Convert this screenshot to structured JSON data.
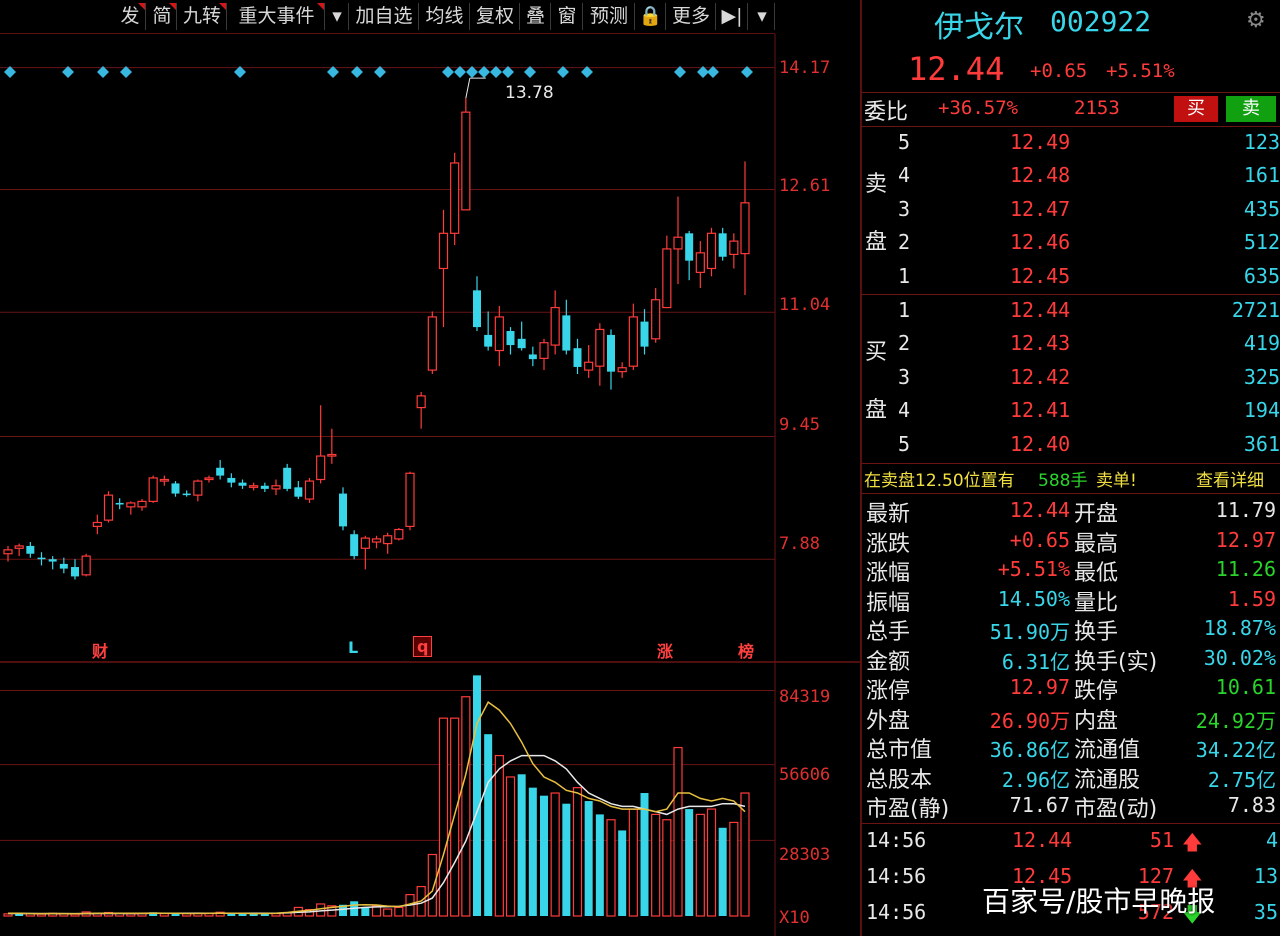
{
  "toolbar": {
    "items": [
      "发",
      "简",
      "九转",
      "重大事件",
      "▾",
      "加自选",
      "均线",
      "复权",
      "叠",
      "窗",
      "预测",
      "🔒",
      "更多",
      "▶|",
      "▾"
    ]
  },
  "price_axis": {
    "ticks": [
      "14.17",
      "12.61",
      "11.04",
      "9.45",
      "7.88"
    ]
  },
  "volume_axis": {
    "ticks": [
      "84319",
      "56606",
      "28303",
      "X10"
    ]
  },
  "chart_annotation": {
    "high_label": "13.78"
  },
  "event_markers": [
    "财",
    "L",
    "q",
    "涨",
    "榜"
  ],
  "stock": {
    "name": "伊戈尔",
    "code": "002922",
    "price": "12.44",
    "change": "+0.65",
    "change_pct": "+5.51%"
  },
  "weibi": {
    "label": "委比",
    "pct": "+36.57%",
    "diff": "2153",
    "buy_label": "买",
    "sell_label": "卖"
  },
  "sell_side": {
    "label_top": "卖",
    "label_bottom": "盘",
    "levels": [
      {
        "idx": "5",
        "price": "12.49",
        "vol": "123"
      },
      {
        "idx": "4",
        "price": "12.48",
        "vol": "161"
      },
      {
        "idx": "3",
        "price": "12.47",
        "vol": "435"
      },
      {
        "idx": "2",
        "price": "12.46",
        "vol": "512"
      },
      {
        "idx": "1",
        "price": "12.45",
        "vol": "635"
      }
    ]
  },
  "buy_side": {
    "label_top": "买",
    "label_bottom": "盘",
    "levels": [
      {
        "idx": "1",
        "price": "12.44",
        "vol": "2721"
      },
      {
        "idx": "2",
        "price": "12.43",
        "vol": "419"
      },
      {
        "idx": "3",
        "price": "12.42",
        "vol": "325"
      },
      {
        "idx": "4",
        "price": "12.41",
        "vol": "194"
      },
      {
        "idx": "5",
        "price": "12.40",
        "vol": "361"
      }
    ]
  },
  "alert": {
    "prefix": "在卖盘12.50位置有",
    "qty": "588手",
    "suffix": "卖单!",
    "link": "查看详细"
  },
  "stats": [
    {
      "l1": "最新",
      "v1": "12.44",
      "c1": "red",
      "l2": "开盘",
      "v2": "11.79",
      "c2": "white"
    },
    {
      "l1": "涨跌",
      "v1": "+0.65",
      "c1": "red",
      "l2": "最高",
      "v2": "12.97",
      "c2": "red"
    },
    {
      "l1": "涨幅",
      "v1": "+5.51%",
      "c1": "red",
      "l2": "最低",
      "v2": "11.26",
      "c2": "green"
    },
    {
      "l1": "振幅",
      "v1": "14.50%",
      "c1": "cyan",
      "l2": "量比",
      "v2": "1.59",
      "c2": "red"
    },
    {
      "l1": "总手",
      "v1": "51.90万",
      "c1": "cyan",
      "l2": "换手",
      "v2": "18.87%",
      "c2": "cyan"
    },
    {
      "l1": "金额",
      "v1": "6.31亿",
      "c1": "cyan",
      "l2": "换手(实)",
      "v2": "30.02%",
      "c2": "cyan"
    },
    {
      "l1": "涨停",
      "v1": "12.97",
      "c1": "red",
      "l2": "跌停",
      "v2": "10.61",
      "c2": "green"
    },
    {
      "l1": "外盘",
      "v1": "26.90万",
      "c1": "red",
      "l2": "内盘",
      "v2": "24.92万",
      "c2": "green"
    },
    {
      "l1": "总市值",
      "v1": "36.86亿",
      "c1": "cyan",
      "l2": "流通值",
      "v2": "34.22亿",
      "c2": "cyan"
    },
    {
      "l1": "总股本",
      "v1": "2.96亿",
      "c1": "cyan",
      "l2": "流通股",
      "v2": "2.75亿",
      "c2": "cyan"
    },
    {
      "l1": "市盈(静)",
      "v1": "71.67",
      "c1": "white",
      "l2": "市盈(动)",
      "v2": "7.83",
      "c2": "white"
    }
  ],
  "trades": [
    {
      "time": "14:56",
      "price": "12.44",
      "vol": "51",
      "dir": "up",
      "count": "4"
    },
    {
      "time": "14:56",
      "price": "12.45",
      "vol": "127",
      "dir": "up",
      "count": "13"
    },
    {
      "time": "14:56",
      "price": "",
      "vol": "572",
      "dir": "down",
      "count": "35"
    }
  ],
  "watermark": "百家号/股市早晚报",
  "colors": {
    "up": "#ff3b3b",
    "down": "#38d6e8",
    "grid": "#6a1414",
    "ma5": "#e8c040",
    "ma10": "#e8e8e8"
  },
  "chart_data": {
    "type": "candlestick",
    "y_range": [
      7.0,
      14.6
    ],
    "candles": [
      {
        "o": 7.95,
        "h": 8.05,
        "l": 7.85,
        "c": 8.0
      },
      {
        "o": 8.02,
        "h": 8.08,
        "l": 7.92,
        "c": 8.05
      },
      {
        "o": 8.05,
        "h": 8.1,
        "l": 7.9,
        "c": 7.95
      },
      {
        "o": 7.9,
        "h": 7.97,
        "l": 7.8,
        "c": 7.88
      },
      {
        "o": 7.88,
        "h": 7.92,
        "l": 7.75,
        "c": 7.85
      },
      {
        "o": 7.82,
        "h": 7.9,
        "l": 7.7,
        "c": 7.76
      },
      {
        "o": 7.78,
        "h": 7.88,
        "l": 7.62,
        "c": 7.66
      },
      {
        "o": 7.68,
        "h": 7.95,
        "l": 7.66,
        "c": 7.92
      },
      {
        "o": 8.3,
        "h": 8.45,
        "l": 8.2,
        "c": 8.35
      },
      {
        "o": 8.38,
        "h": 8.75,
        "l": 8.35,
        "c": 8.7
      },
      {
        "o": 8.6,
        "h": 8.66,
        "l": 8.52,
        "c": 8.58
      },
      {
        "o": 8.55,
        "h": 8.62,
        "l": 8.45,
        "c": 8.6
      },
      {
        "o": 8.55,
        "h": 8.65,
        "l": 8.5,
        "c": 8.62
      },
      {
        "o": 8.62,
        "h": 8.95,
        "l": 8.6,
        "c": 8.92
      },
      {
        "o": 8.88,
        "h": 8.95,
        "l": 8.82,
        "c": 8.9
      },
      {
        "o": 8.85,
        "h": 8.88,
        "l": 8.68,
        "c": 8.72
      },
      {
        "o": 8.72,
        "h": 8.76,
        "l": 8.68,
        "c": 8.7
      },
      {
        "o": 8.7,
        "h": 8.9,
        "l": 8.62,
        "c": 8.88
      },
      {
        "o": 8.9,
        "h": 8.95,
        "l": 8.86,
        "c": 8.92
      },
      {
        "o": 9.05,
        "h": 9.15,
        "l": 8.9,
        "c": 8.95
      },
      {
        "o": 8.92,
        "h": 8.98,
        "l": 8.8,
        "c": 8.86
      },
      {
        "o": 8.86,
        "h": 8.9,
        "l": 8.78,
        "c": 8.82
      },
      {
        "o": 8.8,
        "h": 8.86,
        "l": 8.76,
        "c": 8.82
      },
      {
        "o": 8.82,
        "h": 8.86,
        "l": 8.74,
        "c": 8.78
      },
      {
        "o": 8.78,
        "h": 8.9,
        "l": 8.7,
        "c": 8.82
      },
      {
        "o": 9.05,
        "h": 9.1,
        "l": 8.75,
        "c": 8.78
      },
      {
        "o": 8.8,
        "h": 8.88,
        "l": 8.65,
        "c": 8.68
      },
      {
        "o": 8.65,
        "h": 8.92,
        "l": 8.6,
        "c": 8.88
      },
      {
        "o": 8.9,
        "h": 9.85,
        "l": 8.85,
        "c": 9.2
      },
      {
        "o": 9.2,
        "h": 9.55,
        "l": 9.1,
        "c": 9.22
      },
      {
        "o": 8.72,
        "h": 8.8,
        "l": 8.25,
        "c": 8.3
      },
      {
        "o": 8.2,
        "h": 8.25,
        "l": 7.88,
        "c": 7.92
      },
      {
        "o": 8.02,
        "h": 8.18,
        "l": 7.75,
        "c": 8.15
      },
      {
        "o": 8.1,
        "h": 8.18,
        "l": 8.02,
        "c": 8.14
      },
      {
        "o": 8.08,
        "h": 8.22,
        "l": 7.95,
        "c": 8.18
      },
      {
        "o": 8.14,
        "h": 8.28,
        "l": 8.12,
        "c": 8.26
      },
      {
        "o": 8.3,
        "h": 9.0,
        "l": 8.25,
        "c": 8.98
      },
      {
        "o": 9.82,
        "h": 10.02,
        "l": 9.55,
        "c": 9.97
      },
      {
        "o": 10.3,
        "h": 11.05,
        "l": 10.25,
        "c": 10.98
      },
      {
        "o": 11.6,
        "h": 12.35,
        "l": 10.85,
        "c": 12.05
      },
      {
        "o": 12.05,
        "h": 13.08,
        "l": 11.9,
        "c": 12.95
      },
      {
        "o": 12.35,
        "h": 13.78,
        "l": 12.35,
        "c": 13.6
      },
      {
        "o": 11.32,
        "h": 11.5,
        "l": 10.8,
        "c": 10.85
      },
      {
        "o": 10.75,
        "h": 11.05,
        "l": 10.55,
        "c": 10.6
      },
      {
        "o": 10.55,
        "h": 11.12,
        "l": 10.35,
        "c": 10.98
      },
      {
        "o": 10.8,
        "h": 10.85,
        "l": 10.5,
        "c": 10.62
      },
      {
        "o": 10.7,
        "h": 10.92,
        "l": 10.55,
        "c": 10.58
      },
      {
        "o": 10.5,
        "h": 10.6,
        "l": 10.35,
        "c": 10.44
      },
      {
        "o": 10.45,
        "h": 10.7,
        "l": 10.3,
        "c": 10.65
      },
      {
        "o": 10.62,
        "h": 11.32,
        "l": 10.5,
        "c": 11.1
      },
      {
        "o": 11.0,
        "h": 11.2,
        "l": 10.5,
        "c": 10.55
      },
      {
        "o": 10.58,
        "h": 10.7,
        "l": 10.25,
        "c": 10.34
      },
      {
        "o": 10.3,
        "h": 10.62,
        "l": 10.2,
        "c": 10.4
      },
      {
        "o": 10.35,
        "h": 10.9,
        "l": 10.1,
        "c": 10.82
      },
      {
        "o": 10.75,
        "h": 10.82,
        "l": 10.05,
        "c": 10.28
      },
      {
        "o": 10.28,
        "h": 10.4,
        "l": 10.2,
        "c": 10.33
      },
      {
        "o": 10.35,
        "h": 11.15,
        "l": 10.3,
        "c": 10.98
      },
      {
        "o": 10.92,
        "h": 11.08,
        "l": 10.5,
        "c": 10.6
      },
      {
        "o": 10.7,
        "h": 11.35,
        "l": 10.65,
        "c": 11.2
      },
      {
        "o": 11.1,
        "h": 12.02,
        "l": 11.1,
        "c": 11.85
      },
      {
        "o": 11.85,
        "h": 12.52,
        "l": 11.4,
        "c": 12.0
      },
      {
        "o": 12.05,
        "h": 12.08,
        "l": 11.45,
        "c": 11.7
      },
      {
        "o": 11.55,
        "h": 11.95,
        "l": 11.35,
        "c": 11.8
      },
      {
        "o": 11.6,
        "h": 12.12,
        "l": 11.5,
        "c": 12.05
      },
      {
        "o": 12.05,
        "h": 12.12,
        "l": 11.7,
        "c": 11.75
      },
      {
        "o": 11.78,
        "h": 12.05,
        "l": 11.6,
        "c": 11.95
      },
      {
        "o": 11.79,
        "h": 12.97,
        "l": 11.26,
        "c": 12.44
      }
    ],
    "volume_y_range": [
      0,
      95000
    ],
    "volumes": [
      800,
      1200,
      900,
      700,
      1000,
      800,
      700,
      1500,
      900,
      1300,
      1000,
      800,
      900,
      1400,
      900,
      800,
      900,
      1100,
      900,
      1400,
      1000,
      900,
      800,
      1000,
      900,
      1300,
      3200,
      2400,
      4500,
      3800,
      4200,
      5500,
      3000,
      3800,
      2600,
      3200,
      8000,
      11000,
      23000,
      74000,
      74000,
      82000,
      90000,
      68000,
      60000,
      52000,
      53000,
      48000,
      45000,
      46000,
      42000,
      48000,
      43000,
      38000,
      36000,
      32000,
      40000,
      46000,
      38000,
      36000,
      63000,
      40000,
      38000,
      40000,
      33000,
      35000,
      46000
    ],
    "volume_colors": [
      "up",
      "down",
      "up",
      "up",
      "up",
      "up",
      "up",
      "up",
      "up",
      "up",
      "up",
      "up",
      "up",
      "down",
      "up",
      "down",
      "up",
      "up",
      "up",
      "up",
      "down",
      "down",
      "down",
      "down",
      "up",
      "up",
      "up",
      "up",
      "up",
      "up",
      "down",
      "down",
      "down",
      "up",
      "up",
      "up",
      "up",
      "up",
      "up",
      "up",
      "up",
      "up",
      "down",
      "down",
      "up",
      "up",
      "down",
      "down",
      "down",
      "up",
      "down",
      "up",
      "down",
      "down",
      "up",
      "down",
      "up",
      "down",
      "up",
      "up",
      "up",
      "down",
      "up",
      "up",
      "down",
      "up",
      "up"
    ],
    "ma5": [
      1000,
      1000,
      900,
      900,
      950,
      900,
      850,
      950,
      1000,
      1050,
      1050,
      1000,
      1050,
      1100,
      1000,
      1000,
      950,
      950,
      1000,
      1100,
      1050,
      1000,
      900,
      950,
      1000,
      1300,
      1800,
      2100,
      2700,
      3200,
      3600,
      4100,
      4200,
      4100,
      3700,
      3500,
      4500,
      5600,
      9300,
      23000,
      38000,
      53000,
      72000,
      80000,
      77000,
      72000,
      65000,
      57000,
      52000,
      50000,
      47000,
      46000,
      44000,
      43000,
      41000,
      40000,
      40000,
      40000,
      39000,
      40000,
      46000,
      46000,
      44000,
      43000,
      44000,
      43000,
      39000
    ],
    "ma10": [
      950,
      950,
      950,
      900,
      900,
      900,
      900,
      900,
      950,
      950,
      950,
      950,
      950,
      1000,
      1000,
      1050,
      1000,
      1000,
      1000,
      1050,
      1050,
      1000,
      1000,
      1000,
      1000,
      1150,
      1400,
      1550,
      1900,
      2200,
      2500,
      2900,
      3200,
      3400,
      3500,
      3600,
      4100,
      4800,
      6700,
      12500,
      20000,
      28000,
      39000,
      50000,
      55000,
      58000,
      60000,
      60000,
      60000,
      58000,
      55000,
      50000,
      46000,
      44000,
      42000,
      41000,
      41000,
      40000,
      39000,
      38000,
      40000,
      41000,
      41000,
      41000,
      42000,
      42000,
      41000
    ],
    "dots_x": [
      10,
      68,
      103,
      126,
      240,
      333,
      357,
      380,
      448,
      460,
      472,
      484,
      496,
      508,
      530,
      563,
      587,
      680,
      703,
      713,
      747
    ]
  }
}
